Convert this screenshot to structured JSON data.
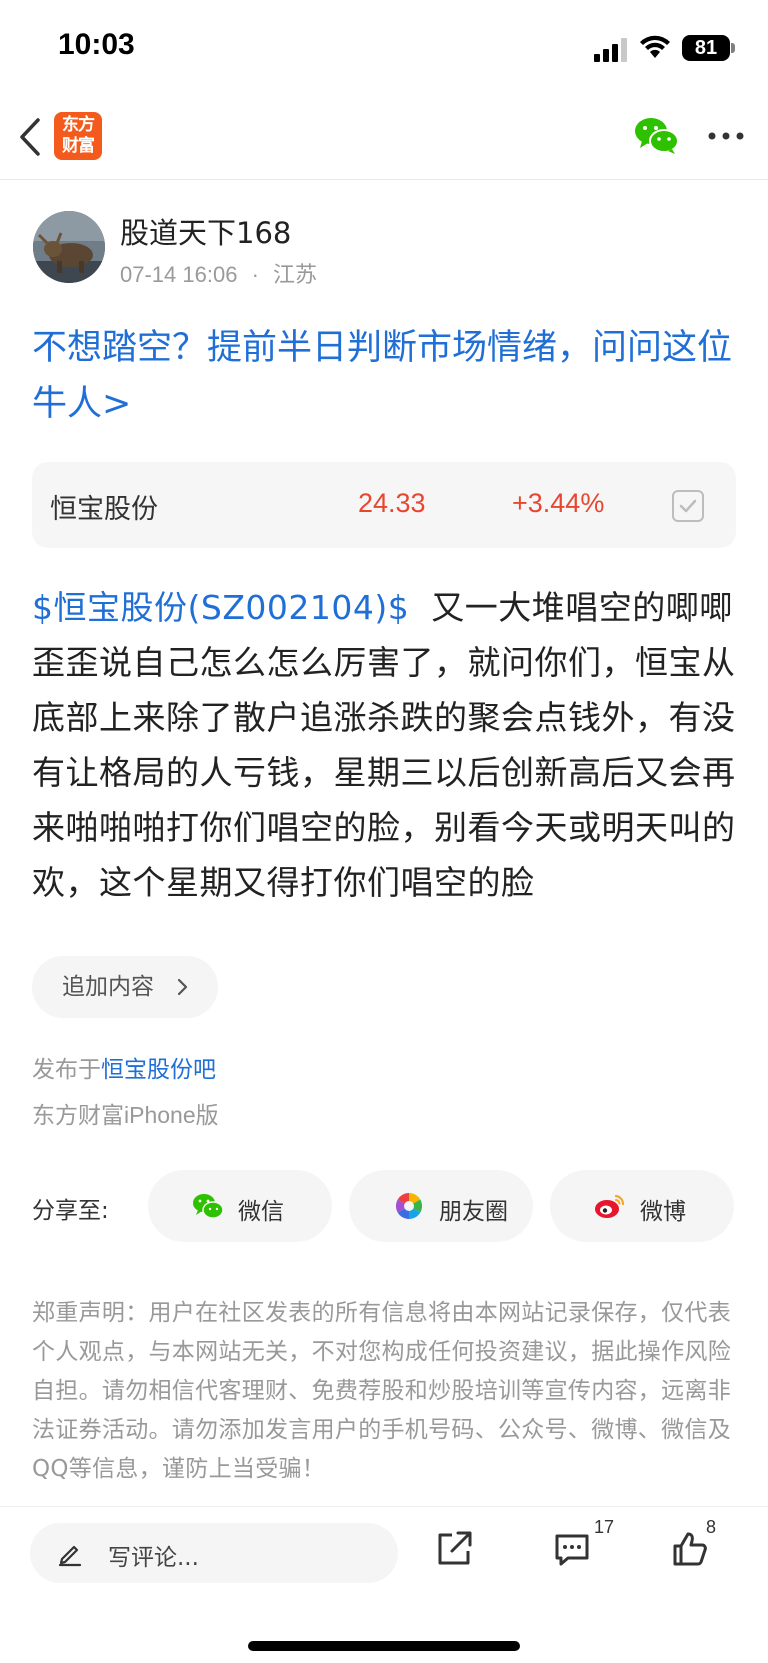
{
  "status_bar": {
    "time": "10:03",
    "battery": "81"
  },
  "nav": {
    "logo_line1": "东方",
    "logo_line2": "财富",
    "logo_color": "#f35a1b",
    "icons": [
      "back-arrow-icon",
      "wechat-icon",
      "more-dots-icon"
    ]
  },
  "author": {
    "name": "股道天下168",
    "date": "07-14 16:06",
    "separator": "·",
    "location": "江苏"
  },
  "promo": {
    "text": "不想踏空？提前半日判断市场情绪，问问这位牛人>"
  },
  "stock": {
    "name": "恒宝股份",
    "price": "24.33",
    "change": "+3.44%",
    "up_color": "#e8472f"
  },
  "post": {
    "tag": "$恒宝股份(SZ002104)$",
    "body": "  又一大堆唱空的唧唧歪歪说自己怎么怎么厉害了，就问你们，恒宝从底部上来除了散户追涨杀跌的聚会点钱外，有没有让格局的人亏钱，星期三以后创新高后又会再来啪啪啪打你们唱空的脸，别看今天或明天叫的欢，这个星期又得打你们唱空的脸"
  },
  "add_content": {
    "label": "追加内容"
  },
  "published": {
    "prefix": "发布于",
    "bar": "恒宝股份吧",
    "client": "东方财富iPhone版"
  },
  "share": {
    "label": "分享至:",
    "buttons": [
      {
        "label": "微信",
        "icon": "wechat-icon"
      },
      {
        "label": "朋友圈",
        "icon": "moments-icon"
      },
      {
        "label": "微博",
        "icon": "weibo-icon"
      }
    ]
  },
  "disclaimer": "郑重声明：用户在社区发表的所有信息将由本网站记录保存，仅代表个人观点，与本网站无关，不对您构成任何投资建议，据此操作风险自担。请勿相信代客理财、免费荐股和炒股培训等宣传内容，远离非法证券活动。请勿添加发言用户的手机号码、公众号、微博、微信及QQ等信息，谨防上当受骗！",
  "bottom_bar": {
    "comment_placeholder": "写评论...",
    "comment_count": "17",
    "like_count": "8"
  },
  "colors": {
    "link_blue": "#1f6fd6",
    "wechat_green": "#2dc100"
  }
}
